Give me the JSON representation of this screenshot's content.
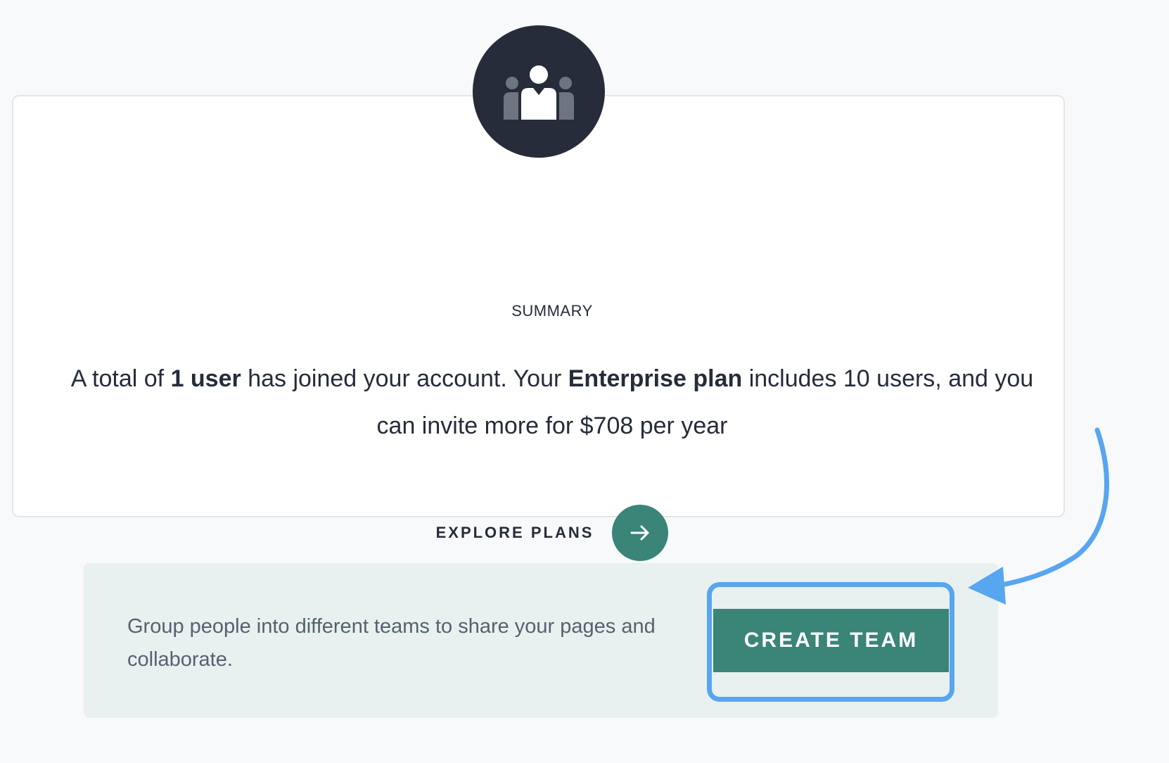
{
  "summary": {
    "label": "SUMMARY",
    "text_part1": "A total of ",
    "user_count": "1 user",
    "text_part2": " has joined your account. Your ",
    "plan_name": "Enterprise plan",
    "text_part3": " includes 10 users, and you can invite more for $708 per year",
    "explore_label": "EXPLORE PLANS",
    "explore_icon": "arrow-right-icon",
    "avatar_icon": "team-icon"
  },
  "teams": {
    "description": "Group people into different teams to share your pages and collaborate.",
    "create_button_label": "CREATE TEAM"
  },
  "colors": {
    "background": "#f8f9fa",
    "card": "#ffffff",
    "avatar": "#262c3a",
    "accent_green": "#3a8478",
    "team_panel": "#e8f1ef",
    "annotation_blue": "#58a5f0"
  }
}
